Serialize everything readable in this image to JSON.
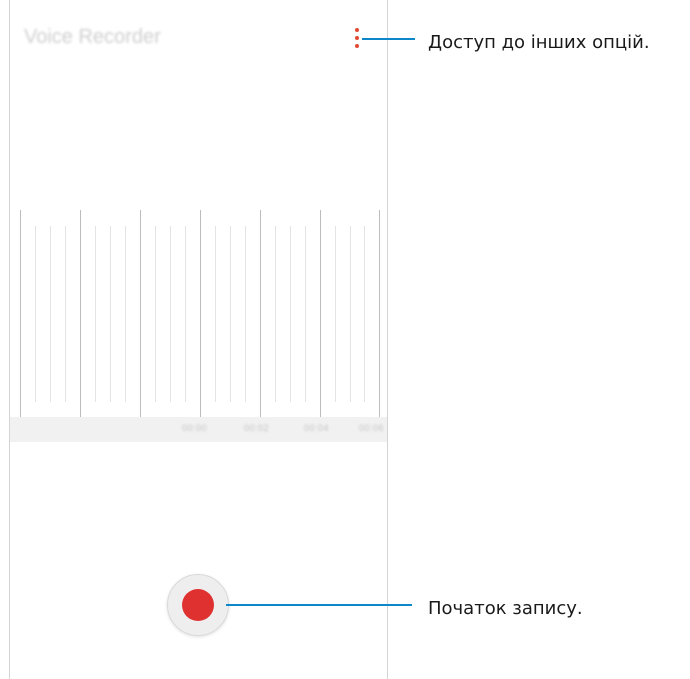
{
  "app": {
    "title": "Voice Recorder",
    "more_options_icon": "more-vert-icon",
    "record_icon": "record-icon"
  },
  "timeline": {
    "time_labels": [
      "00:00",
      "00:02",
      "00:04",
      "00:06"
    ]
  },
  "callouts": {
    "more_options": "Доступ до інших опцій.",
    "record": "Початок запису."
  },
  "colors": {
    "accent_dot": "#e04a35",
    "record": "#e03131",
    "callout_line": "#0c87c9"
  }
}
